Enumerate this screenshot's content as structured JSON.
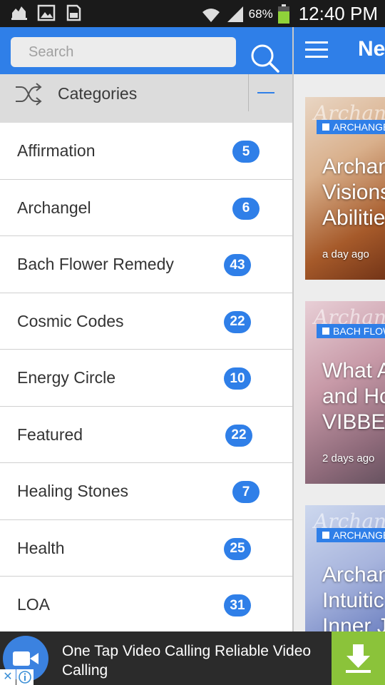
{
  "status_bar": {
    "battery": "68%",
    "time": "12:40 PM"
  },
  "drawer": {
    "search": {
      "placeholder": "Search"
    },
    "categories_header": "Categories",
    "categories": [
      {
        "label": "Affirmation",
        "count": "5"
      },
      {
        "label": "Archangel",
        "count": "6"
      },
      {
        "label": "Bach Flower Remedy",
        "count": "43"
      },
      {
        "label": "Cosmic Codes",
        "count": "22"
      },
      {
        "label": "Energy Circle",
        "count": "10"
      },
      {
        "label": "Featured",
        "count": "22"
      },
      {
        "label": "Healing Stones",
        "count": "7"
      },
      {
        "label": "Health",
        "count": "25"
      },
      {
        "label": "LOA",
        "count": "31"
      }
    ]
  },
  "main": {
    "title": "Ne",
    "cards": [
      {
        "category": "ARCHANGE",
        "watermark": "Archan",
        "title_lines": [
          "Archan",
          "Visions",
          "Abilitie"
        ],
        "time": "a day ago"
      },
      {
        "category": "BACH FLOW",
        "watermark": "Archan",
        "title_lines": [
          "What A",
          "and Ho",
          "VIBBES"
        ],
        "time": "2 days ago"
      },
      {
        "category": "ARCHANGE",
        "watermark": "Archan",
        "title_lines": [
          "Archan",
          "Intuitic",
          "Inner J"
        ],
        "time": ""
      }
    ]
  },
  "ad": {
    "text": "One Tap Video Calling Reliable Video Calling",
    "close_symbol": "✕"
  },
  "colors": {
    "accent": "#2f7fe8",
    "ad_green": "#8bc33a"
  }
}
